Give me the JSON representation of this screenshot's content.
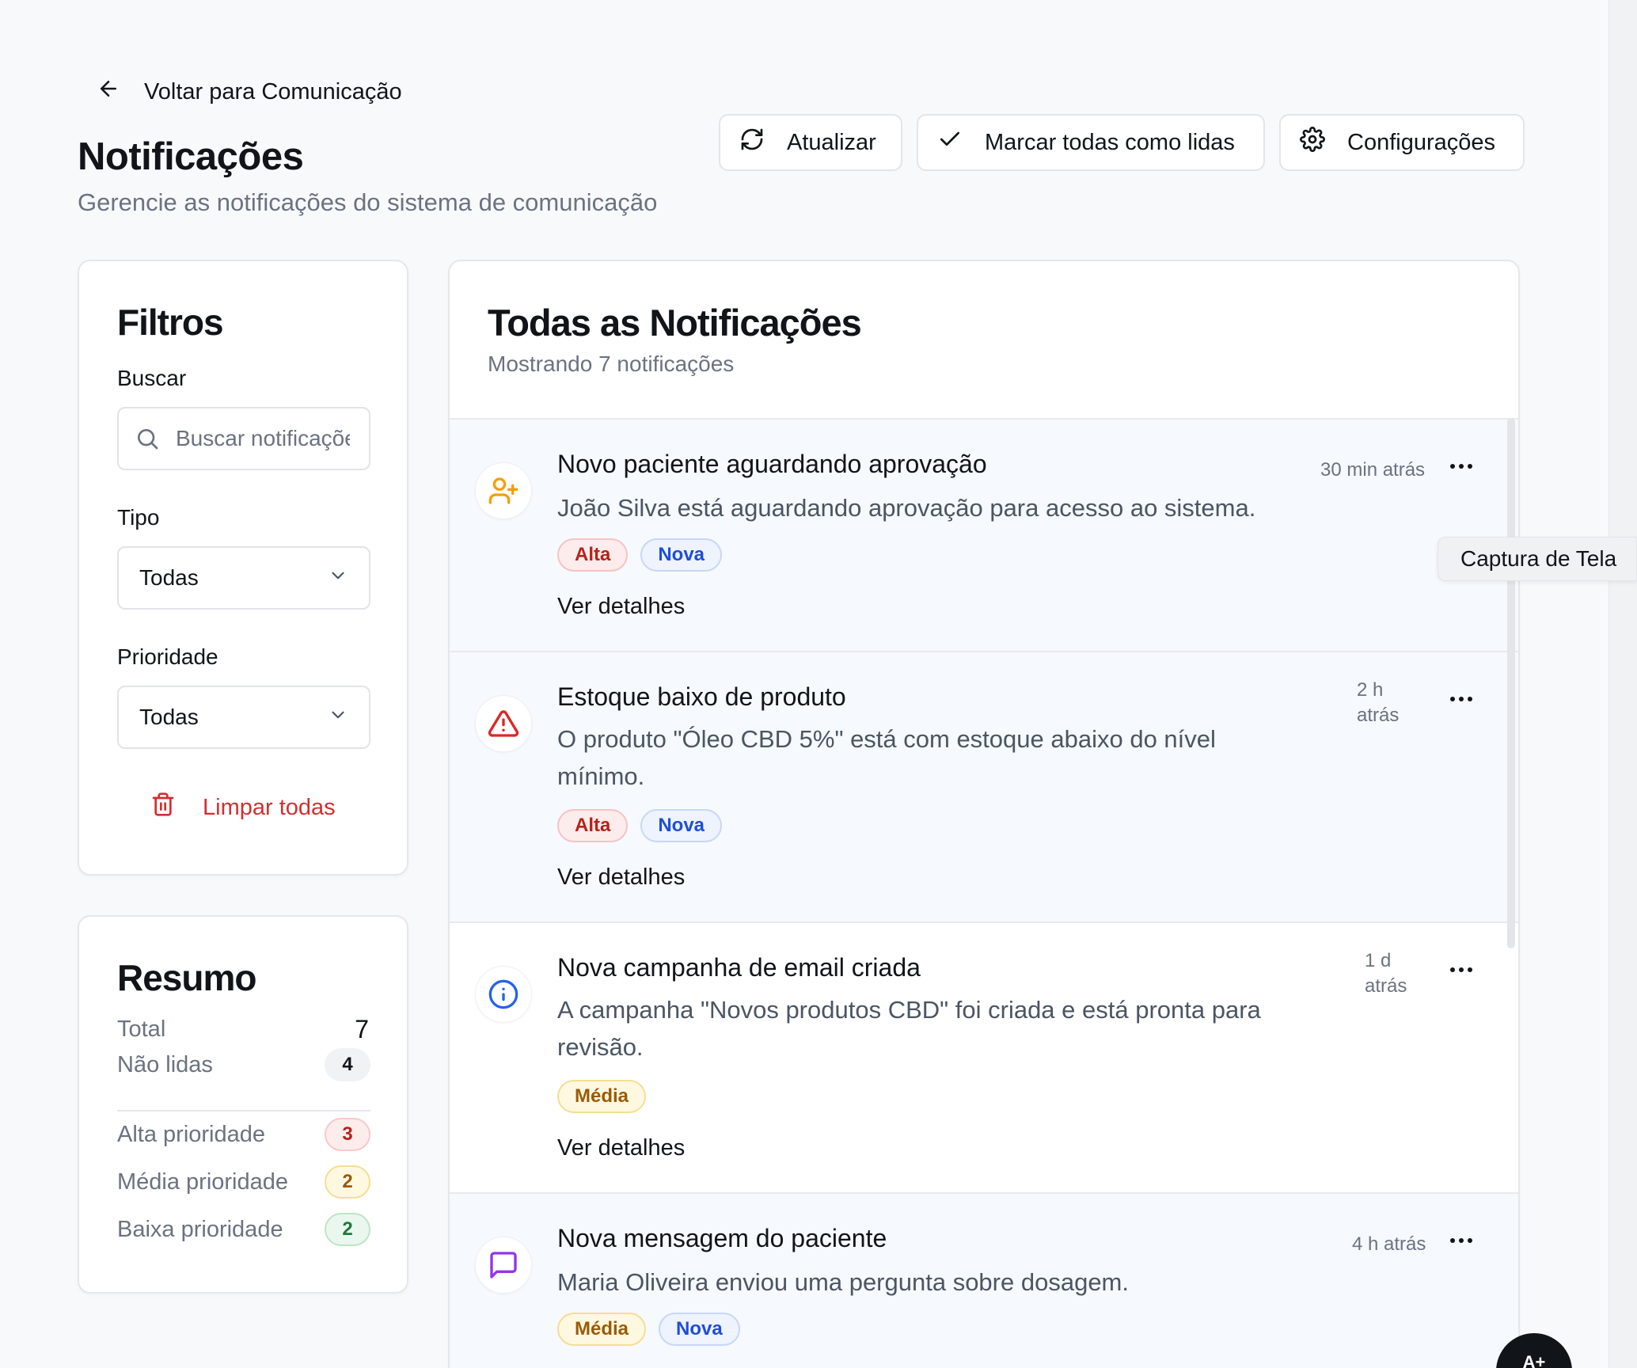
{
  "back_link": {
    "label": "Voltar para Comunicação"
  },
  "header": {
    "title": "Notificações",
    "subtitle": "Gerencie as notificações do sistema de comunicação",
    "buttons": {
      "refresh": "Atualizar",
      "mark_all_read": "Marcar todas como lidas",
      "settings": "Configurações"
    }
  },
  "filters": {
    "title": "Filtros",
    "search_label": "Buscar",
    "search_placeholder": "Buscar notificações...",
    "type_label": "Tipo",
    "type_value": "Todas",
    "priority_label": "Prioridade",
    "priority_value": "Todas",
    "clear_label": "Limpar todas"
  },
  "summary": {
    "title": "Resumo",
    "total_label": "Total",
    "total_value": "7",
    "unread_label": "Não lidas",
    "unread_value": "4",
    "high_label": "Alta prioridade",
    "high_value": "3",
    "medium_label": "Média prioridade",
    "medium_value": "2",
    "low_label": "Baixa prioridade",
    "low_value": "2"
  },
  "main": {
    "title": "Todas as Notificações",
    "subtitle": "Mostrando 7 notificações",
    "notifications": [
      {
        "icon": "user-plus-icon",
        "title": "Novo paciente aguardando aprovação",
        "body": "João Silva está aguardando aprovação para acesso ao sistema.",
        "time": "30 min atrás",
        "tags": [
          "Alta",
          "Nova"
        ],
        "details": "Ver detalhes"
      },
      {
        "icon": "warning-triangle-icon",
        "title": "Estoque baixo de produto",
        "body": "O produto \"Óleo CBD 5%\" está com estoque abaixo do nível mínimo.",
        "time_line1": "2 h",
        "time_line2": "atrás",
        "tags": [
          "Alta",
          "Nova"
        ],
        "details": "Ver detalhes"
      },
      {
        "icon": "info-circle-icon",
        "title": "Nova campanha de email criada",
        "body": "A campanha \"Novos produtos CBD\" foi criada e está pronta para revisão.",
        "time_line1": "1 d",
        "time_line2": "atrás",
        "tags": [
          "Média"
        ],
        "details": "Ver detalhes"
      },
      {
        "icon": "message-square-icon",
        "title": "Nova mensagem do paciente",
        "body": "Maria Oliveira enviou uma pergunta sobre dosagem.",
        "time": "4 h atrás",
        "tags": [
          "Média",
          "Nova"
        ]
      }
    ]
  },
  "tooltip": {
    "label": "Captura de Tela"
  },
  "fab": {
    "label": "A+"
  },
  "colors": {
    "danger": "#d32f2f",
    "warning_icon": "#f59e0b",
    "info_icon": "#2563eb",
    "message_icon": "#9333ea"
  }
}
